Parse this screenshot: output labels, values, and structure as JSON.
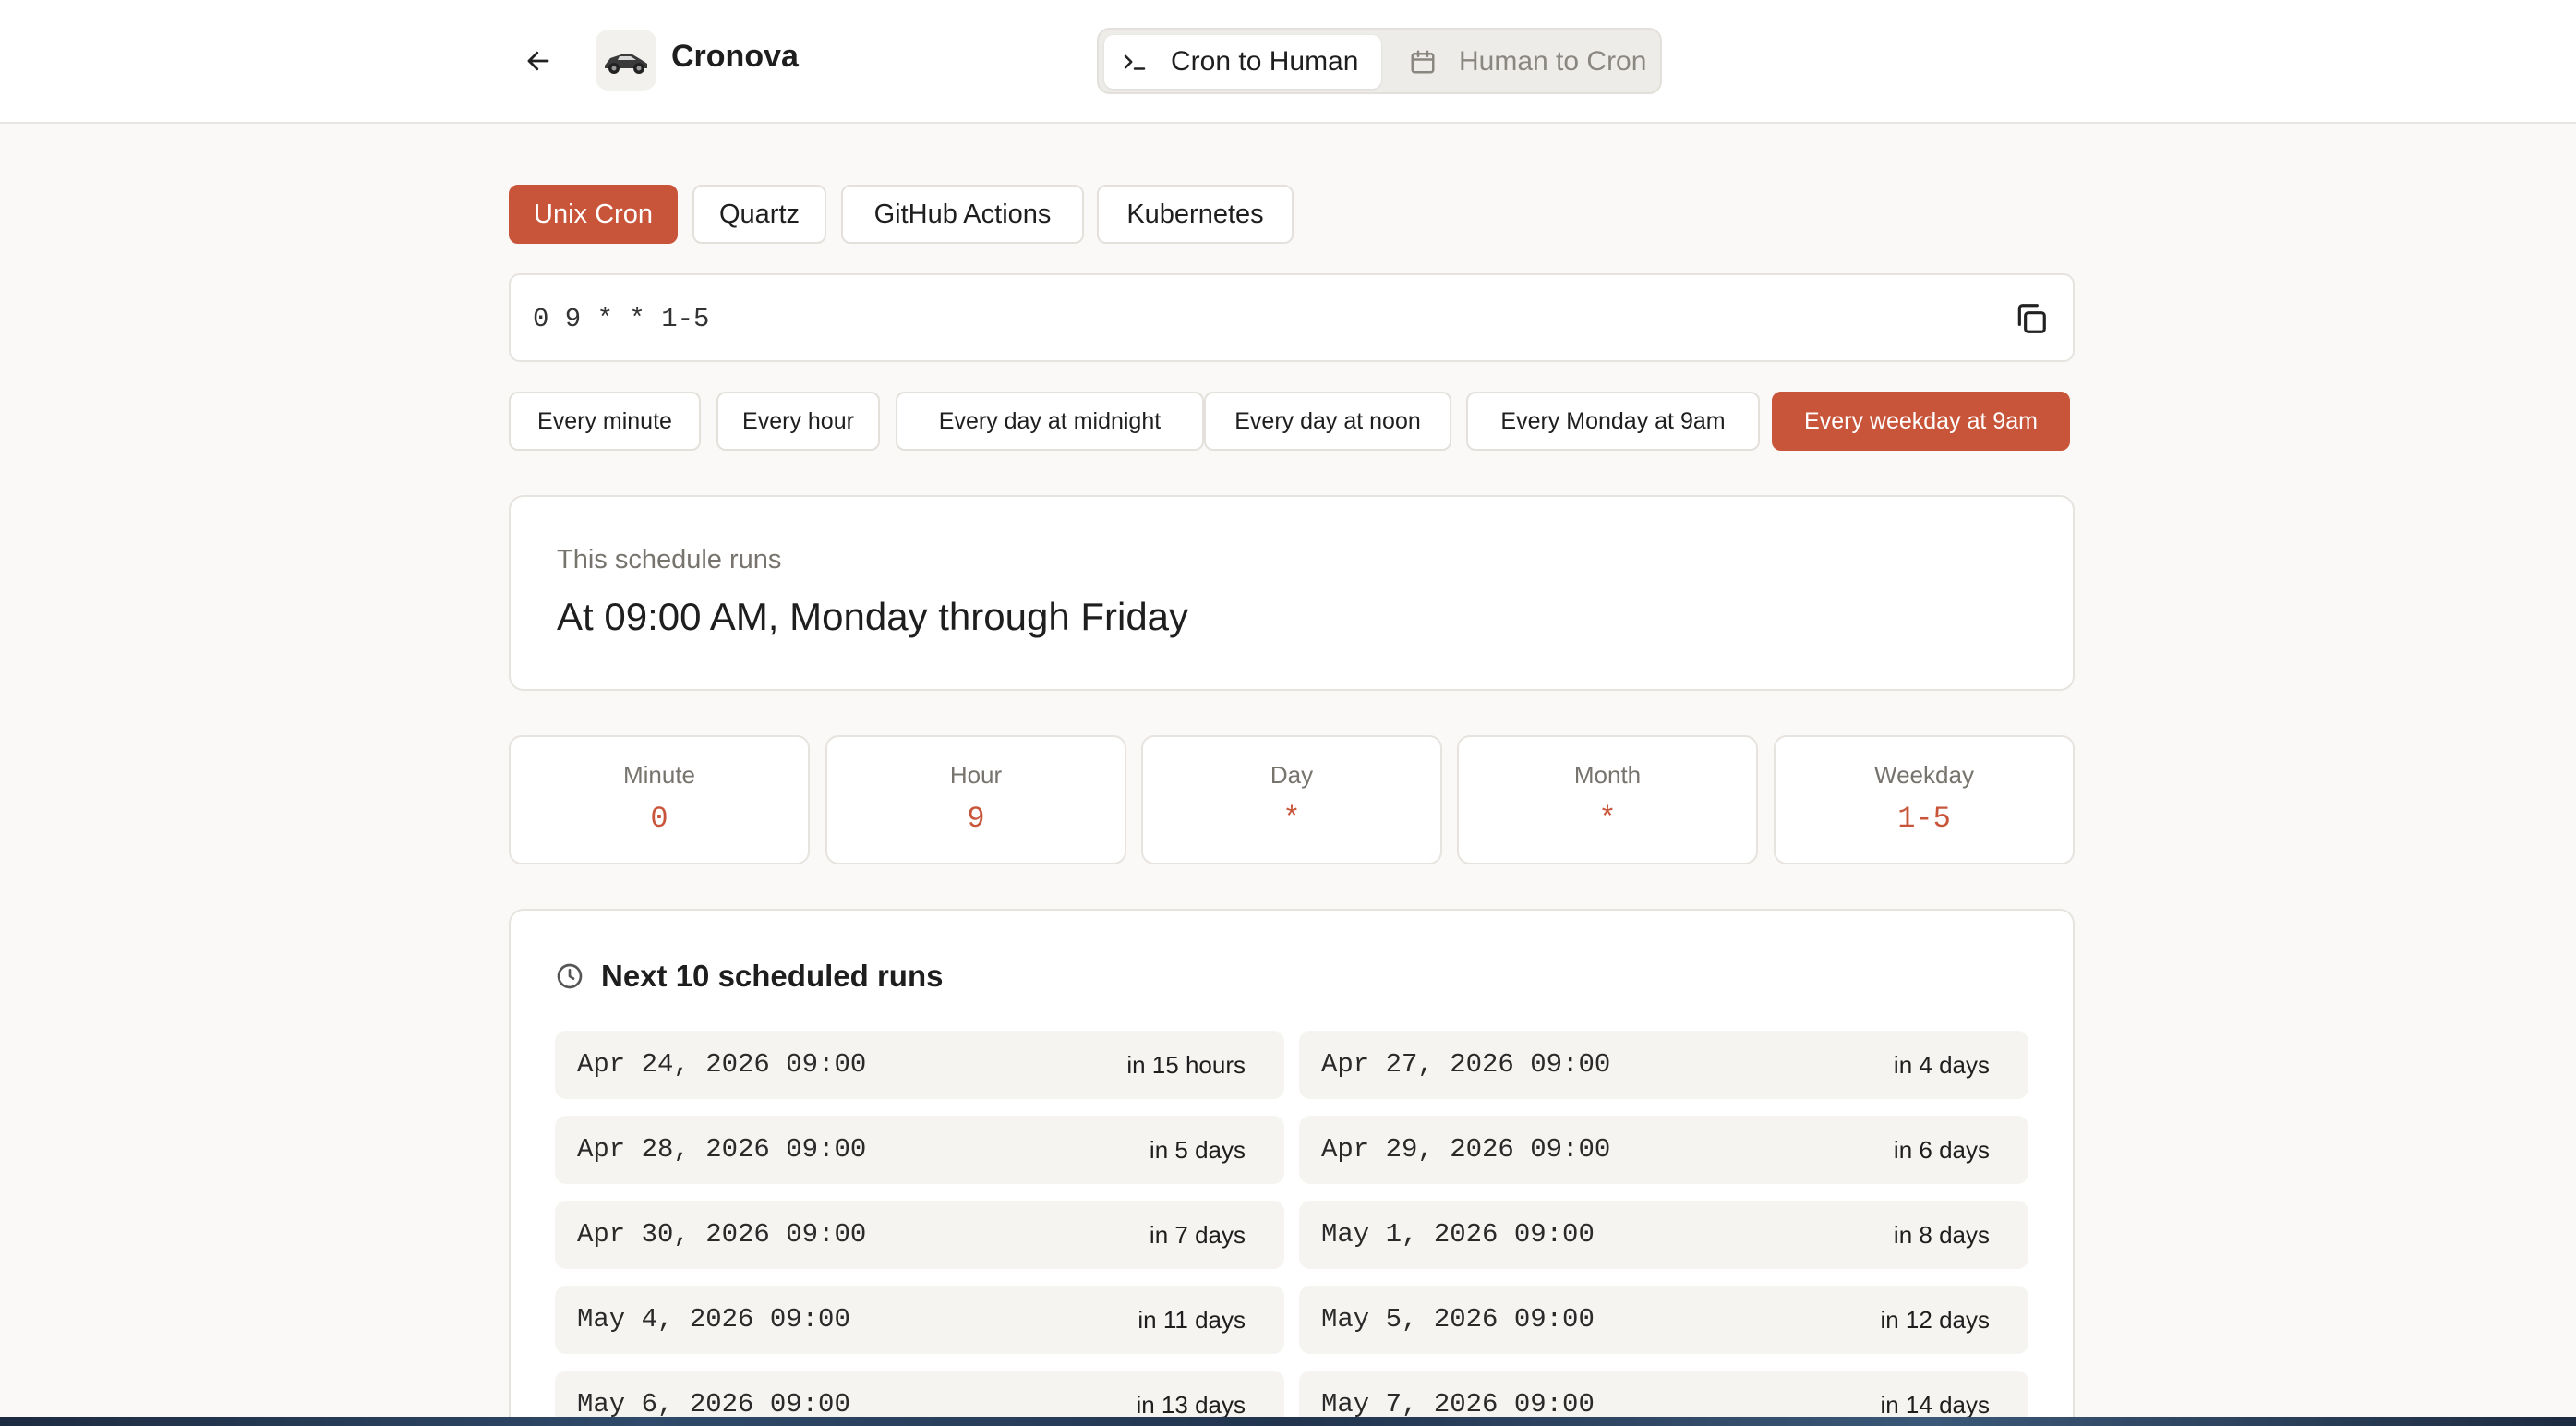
{
  "header": {
    "app_name": "Cronova",
    "modes": [
      {
        "label": "Cron to Human",
        "icon": "terminal-icon",
        "active": true
      },
      {
        "label": "Human to Cron",
        "icon": "calendar-icon",
        "active": false
      }
    ]
  },
  "dialects": [
    {
      "label": "Unix Cron",
      "active": true
    },
    {
      "label": "Quartz",
      "active": false
    },
    {
      "label": "GitHub Actions",
      "active": false
    },
    {
      "label": "Kubernetes",
      "active": false
    }
  ],
  "expression": {
    "value": "0 9 * * 1-5"
  },
  "presets": [
    {
      "label": "Every minute",
      "active": false
    },
    {
      "label": "Every hour",
      "active": false
    },
    {
      "label": "Every day at midnight",
      "active": false
    },
    {
      "label": "Every day at noon",
      "active": false
    },
    {
      "label": "Every Monday at 9am",
      "active": false
    },
    {
      "label": "Every weekday at 9am",
      "active": true
    }
  ],
  "summary": {
    "label": "This schedule runs",
    "text": "At 09:00 AM, Monday through Friday"
  },
  "fields": [
    {
      "label": "Minute",
      "value": "0"
    },
    {
      "label": "Hour",
      "value": "9"
    },
    {
      "label": "Day",
      "value": "*"
    },
    {
      "label": "Month",
      "value": "*"
    },
    {
      "label": "Weekday",
      "value": "1-5"
    }
  ],
  "runs": {
    "title": "Next 10 scheduled runs",
    "items": [
      {
        "date": "Apr 24, 2026 09:00",
        "relative": "in 15 hours"
      },
      {
        "date": "Apr 27, 2026 09:00",
        "relative": "in 4 days"
      },
      {
        "date": "Apr 28, 2026 09:00",
        "relative": "in 5 days"
      },
      {
        "date": "Apr 29, 2026 09:00",
        "relative": "in 6 days"
      },
      {
        "date": "Apr 30, 2026 09:00",
        "relative": "in 7 days"
      },
      {
        "date": "May 1, 2026 09:00",
        "relative": "in 8 days"
      },
      {
        "date": "May 4, 2026 09:00",
        "relative": "in 11 days"
      },
      {
        "date": "May 5, 2026 09:00",
        "relative": "in 12 days"
      },
      {
        "date": "May 6, 2026 09:00",
        "relative": "in 13 days"
      },
      {
        "date": "May 7, 2026 09:00",
        "relative": "in 14 days"
      }
    ]
  },
  "colors": {
    "accent": "#c8553a",
    "background": "#faf9f7"
  }
}
